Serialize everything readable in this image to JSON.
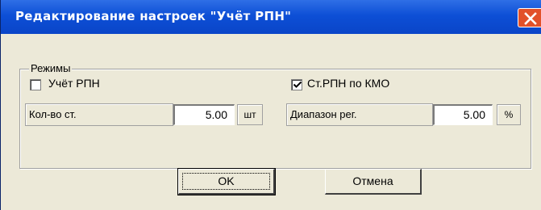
{
  "window": {
    "title": "Редактирование настроек \"Учёт РПН\""
  },
  "group": {
    "label": "Режимы"
  },
  "checkbox_rpn": {
    "label": "Учёт РПН",
    "checked": false
  },
  "checkbox_kmo": {
    "label": "Ст.РПН по КМО",
    "checked": true
  },
  "field_count": {
    "label": "Кол-во ст.",
    "value": "5.00",
    "unit": "шт"
  },
  "field_range": {
    "label": "Диапазон рег.",
    "value": "5.00",
    "unit": "%"
  },
  "buttons": {
    "ok": "OK",
    "cancel": "Отмена"
  },
  "colors": {
    "titlebar": "#0a45c8",
    "close_button": "#e2512a",
    "dialog_background": "#ece9d8"
  }
}
